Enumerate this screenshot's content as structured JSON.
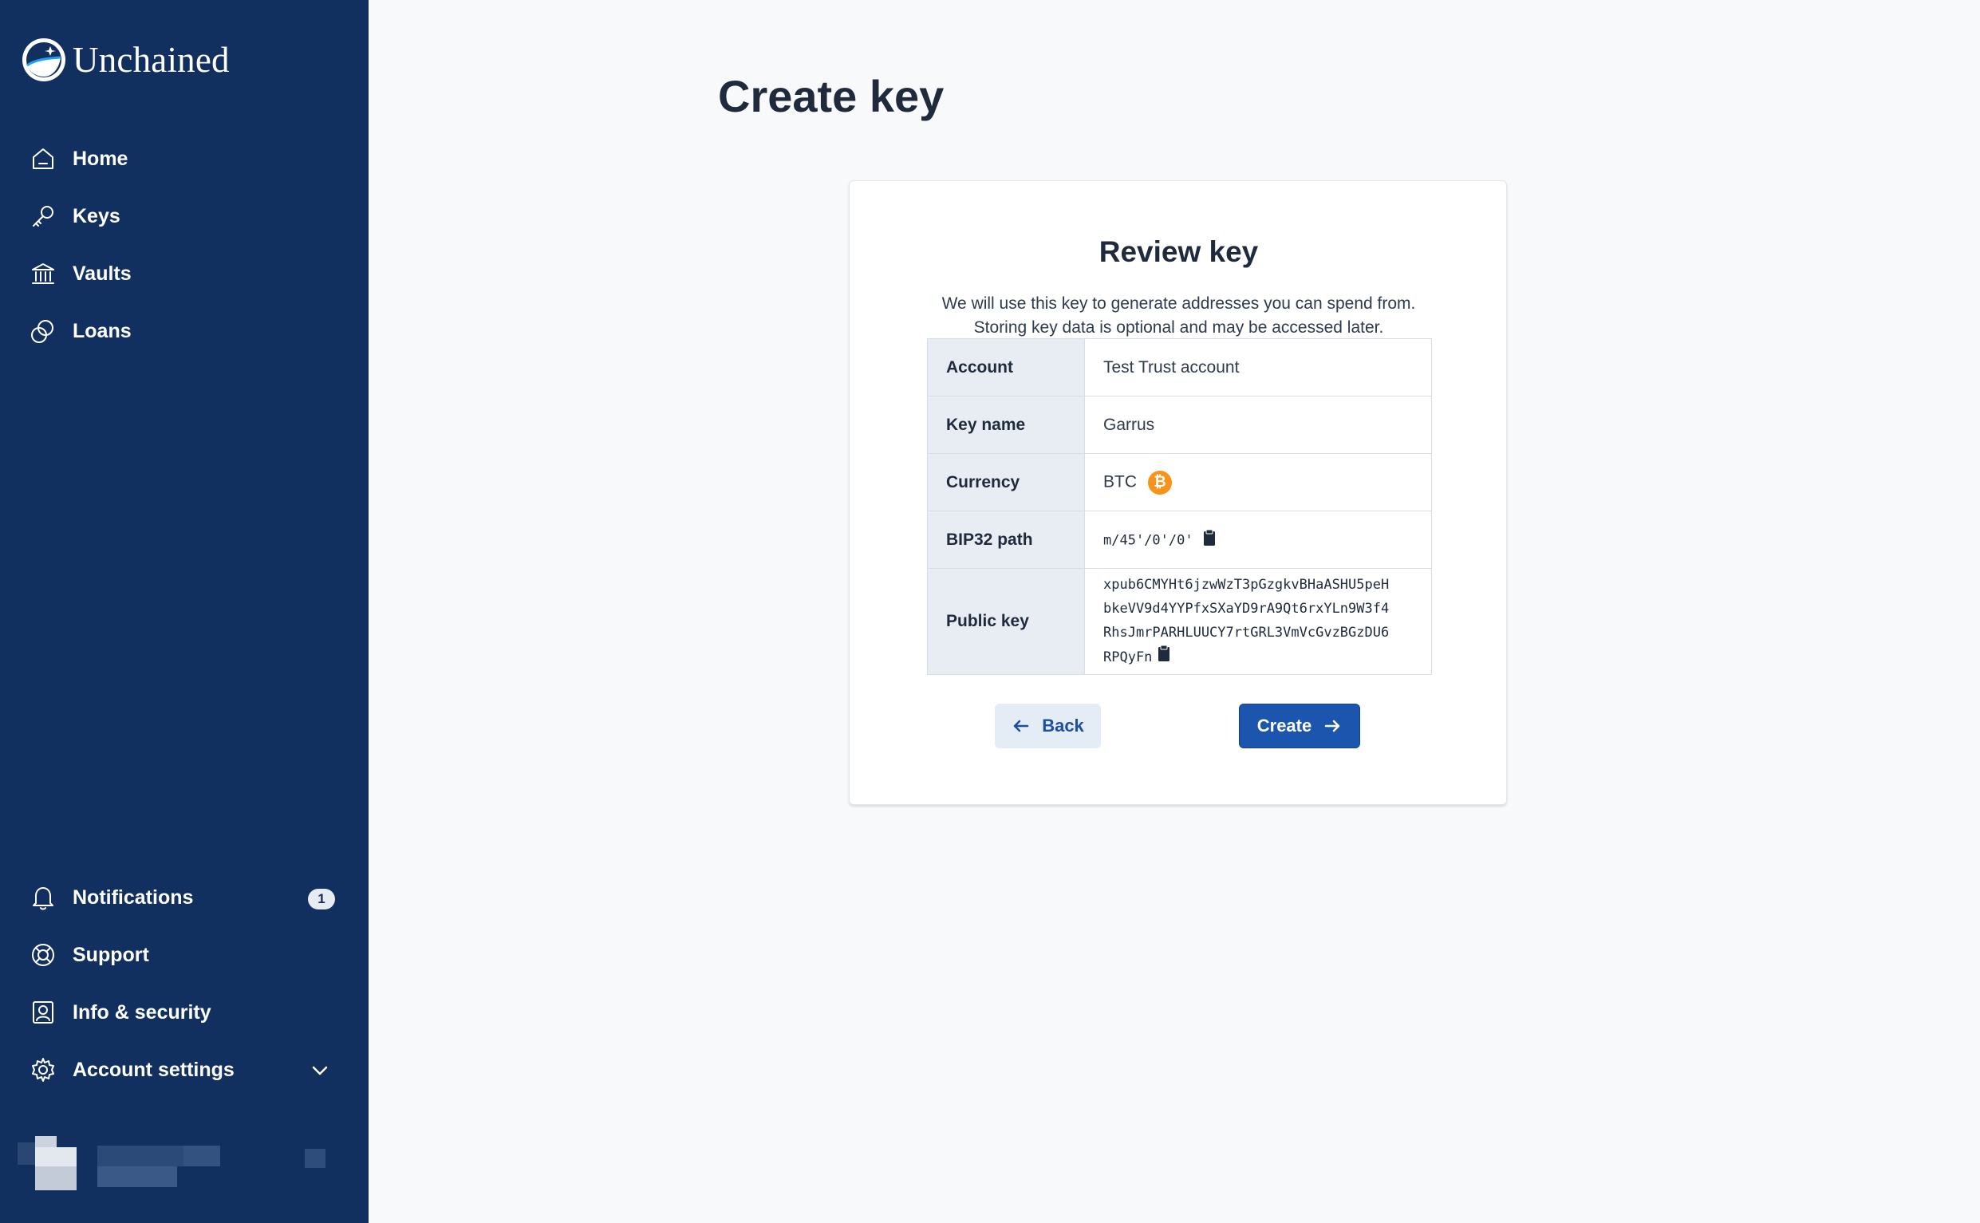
{
  "app": {
    "brand": "Unchained"
  },
  "sidebar": {
    "items": [
      {
        "label": "Home",
        "icon": "home-icon"
      },
      {
        "label": "Keys",
        "icon": "key-icon"
      },
      {
        "label": "Vaults",
        "icon": "bank-icon"
      },
      {
        "label": "Loans",
        "icon": "coins-icon"
      }
    ],
    "bottom_items": [
      {
        "label": "Notifications",
        "icon": "bell-icon",
        "badge": "1"
      },
      {
        "label": "Support",
        "icon": "lifebuoy-icon"
      },
      {
        "label": "Info & security",
        "icon": "user-card-icon"
      },
      {
        "label": "Account settings",
        "icon": "gear-icon"
      }
    ]
  },
  "page": {
    "title": "Create key"
  },
  "review": {
    "title": "Review key",
    "description_line1": "We will use this key to generate addresses you can spend from.",
    "description_line2": "Storing key data is optional and may be accessed later.",
    "rows": {
      "account": {
        "label": "Account",
        "value": "Test Trust account"
      },
      "key_name": {
        "label": "Key name",
        "value": "Garrus"
      },
      "currency": {
        "label": "Currency",
        "value": "BTC",
        "coin_symbol": "₿"
      },
      "bip32_path": {
        "label": "BIP32 path",
        "value": "m/45'/0'/0'"
      },
      "public_key": {
        "label": "Public key",
        "lines": [
          "xpub6CMYHt6jzwWzT3pGzgkvBHaASHU5peH",
          "bkeVV9d4YYPfxSXaYD9rA9Qt6rxYLn9W3f4",
          "RhsJmrPARHLUUCY7rtGRL3VmVcGvzBGzDU6",
          "RPQyFn"
        ]
      }
    },
    "back_label": "Back",
    "create_label": "Create"
  },
  "colors": {
    "sidebar_bg": "#11305f",
    "primary": "#1c55ae",
    "bitcoin": "#f7931a"
  }
}
